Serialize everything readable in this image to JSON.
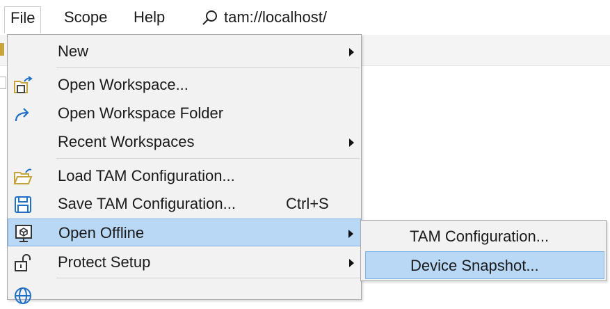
{
  "menubar": {
    "items": [
      {
        "label": "File"
      },
      {
        "label": "Scope"
      },
      {
        "label": "Help"
      }
    ],
    "search_text": "tam://localhost/"
  },
  "file_menu": {
    "items": [
      {
        "label": "New",
        "icon": "",
        "submenu": true
      },
      {
        "label": "Open Workspace...",
        "icon": "open-workspace-icon"
      },
      {
        "label": "Open Workspace Folder",
        "icon": "redo-arrow-icon"
      },
      {
        "label": "Recent Workspaces",
        "icon": "",
        "submenu": true
      },
      {
        "label": "Load TAM Configuration...",
        "icon": "folder-open-icon"
      },
      {
        "label": "Save TAM Configuration...",
        "icon": "save-icon",
        "shortcut": "Ctrl+S"
      },
      {
        "label": "Open Offline",
        "icon": "monitor-cube-icon",
        "submenu": true,
        "highlighted": true
      },
      {
        "label": "Protect Setup",
        "icon": "unlock-icon",
        "submenu": true
      },
      {
        "label": "",
        "icon": "globe-icon"
      }
    ]
  },
  "open_offline_submenu": {
    "items": [
      {
        "label": "TAM Configuration..."
      },
      {
        "label": "Device Snapshot...",
        "highlighted": true
      }
    ]
  },
  "colors": {
    "highlight": "#b8d8f6",
    "highlight_border": "#7fb3e6",
    "menu_bg": "#f2f2f2",
    "icon_accent": "#1f6fc4",
    "icon_folder": "#c8a23a"
  }
}
